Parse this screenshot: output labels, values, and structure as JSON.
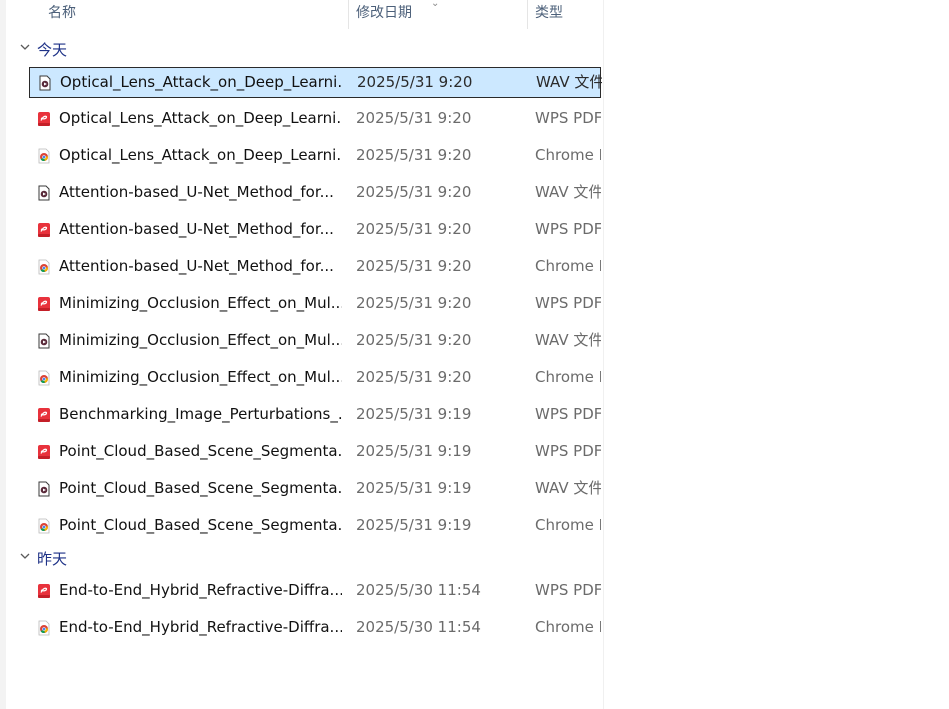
{
  "header": {
    "col_name": "名称",
    "col_date": "修改日期",
    "col_type": "类型"
  },
  "groups": [
    {
      "label": "今天",
      "items": [
        {
          "name": "Optical_Lens_Attack_on_Deep_Learni...",
          "date": "2025/5/31 9:20",
          "type": "WAV 文件",
          "icon": "wav-file-icon",
          "selected": true
        },
        {
          "name": "Optical_Lens_Attack_on_Deep_Learni...",
          "date": "2025/5/31 9:20",
          "type": "WPS PDF",
          "icon": "wps-pdf-icon"
        },
        {
          "name": "Optical_Lens_Attack_on_Deep_Learni...",
          "date": "2025/5/31 9:20",
          "type": "Chrome HTML",
          "icon": "chrome-icon"
        },
        {
          "name": "Attention-based_U-Net_Method_for...",
          "date": "2025/5/31 9:20",
          "type": "WAV 文件",
          "icon": "wav-file-icon"
        },
        {
          "name": "Attention-based_U-Net_Method_for...",
          "date": "2025/5/31 9:20",
          "type": "WPS PDF",
          "icon": "wps-pdf-icon"
        },
        {
          "name": "Attention-based_U-Net_Method_for...",
          "date": "2025/5/31 9:20",
          "type": "Chrome HTML",
          "icon": "chrome-icon"
        },
        {
          "name": "Minimizing_Occlusion_Effect_on_Mul...",
          "date": "2025/5/31 9:20",
          "type": "WPS PDF",
          "icon": "wps-pdf-icon"
        },
        {
          "name": "Minimizing_Occlusion_Effect_on_Mul...",
          "date": "2025/5/31 9:20",
          "type": "WAV 文件",
          "icon": "wav-file-icon"
        },
        {
          "name": "Minimizing_Occlusion_Effect_on_Mul...",
          "date": "2025/5/31 9:20",
          "type": "Chrome HTML",
          "icon": "chrome-icon"
        },
        {
          "name": "Benchmarking_Image_Perturbations_...",
          "date": "2025/5/31 9:19",
          "type": "WPS PDF",
          "icon": "wps-pdf-icon"
        },
        {
          "name": "Point_Cloud_Based_Scene_Segmenta...",
          "date": "2025/5/31 9:19",
          "type": "WPS PDF",
          "icon": "wps-pdf-icon"
        },
        {
          "name": "Point_Cloud_Based_Scene_Segmenta...",
          "date": "2025/5/31 9:19",
          "type": "WAV 文件",
          "icon": "wav-file-icon"
        },
        {
          "name": "Point_Cloud_Based_Scene_Segmenta...",
          "date": "2025/5/31 9:19",
          "type": "Chrome HTML",
          "icon": "chrome-icon"
        }
      ]
    },
    {
      "label": "昨天",
      "items": [
        {
          "name": "End-to-End_Hybrid_Refractive-Diffra...",
          "date": "2025/5/30 11:54",
          "type": "WPS PDF",
          "icon": "wps-pdf-icon"
        },
        {
          "name": "End-to-End_Hybrid_Refractive-Diffra...",
          "date": "2025/5/30 11:54",
          "type": "Chrome HTML",
          "icon": "chrome-icon"
        }
      ]
    }
  ],
  "colors": {
    "selection_bg": "#cce8ff",
    "group_label": "#1e3287",
    "wps_red": "#e8323c",
    "wav_dark": "#3a3a3a"
  }
}
